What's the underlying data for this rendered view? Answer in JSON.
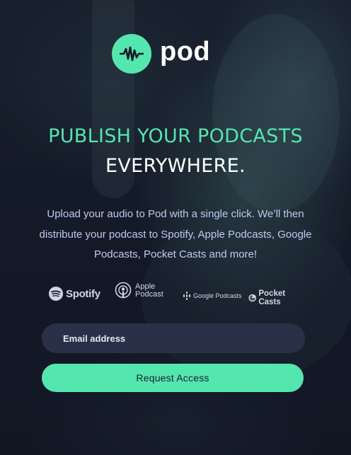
{
  "brand": {
    "name": "pod",
    "accent": "#54e6af",
    "background": "#121725",
    "icon": "sound-wave-icon"
  },
  "hero": {
    "headline_line1": "PUBLISH YOUR PODCASTS",
    "headline_line2": "EVERYWHERE.",
    "description": "Upload your audio to Pod with a single click. We’ll then distribute your podcast to Spotify, Apple Podcasts, Google Podcasts, Pocket Casts and more!"
  },
  "partners": {
    "spotify": "Spotify",
    "apple_line1": "Apple",
    "apple_line2": "Podcast",
    "google": "Google Podcasts",
    "pocket": "Pocket Casts"
  },
  "form": {
    "email_placeholder": "Email address",
    "submit_label": "Request Access"
  }
}
